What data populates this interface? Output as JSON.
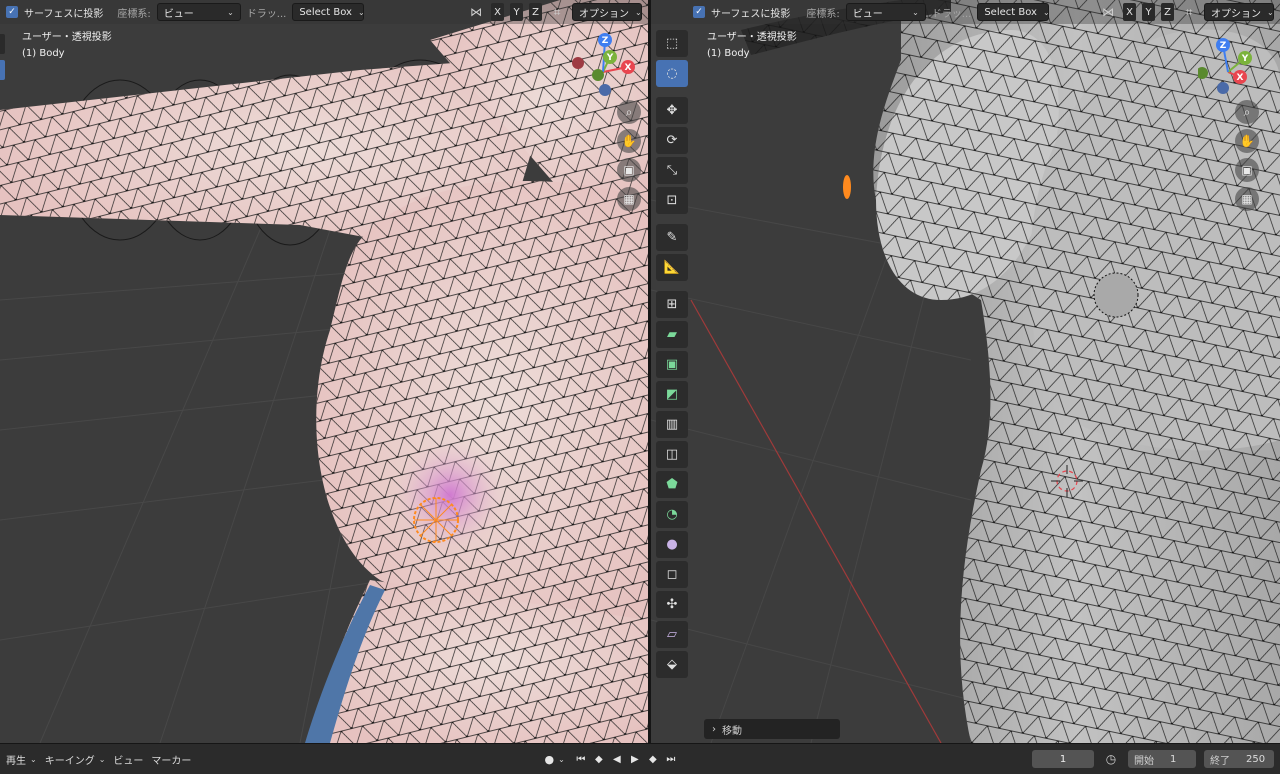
{
  "left_viewport": {
    "header": {
      "surface_project_label": "サーフェスに投影",
      "orientation_label": "座標系:",
      "orientation_value": "ビュー",
      "drag_label": "ドラッ...",
      "drag_value": "Select Box",
      "axes": [
        "X",
        "Y",
        "Z"
      ],
      "options_label": "オプション"
    },
    "info": {
      "view_name": "ユーザー・透視投影",
      "object_name": "(1) Body"
    },
    "gizmo": {
      "x": "X",
      "y": "Y",
      "z": "Z"
    },
    "nav_icons": [
      "zoom-icon",
      "hand-icon",
      "camera-icon",
      "grid-icon"
    ]
  },
  "right_viewport": {
    "header": {
      "surface_project_label": "サーフェスに投影",
      "orientation_label": "座標系:",
      "orientation_value": "ビュー",
      "drag_label": "ドラッ...",
      "drag_value": "Select Box",
      "axes": [
        "X",
        "Y",
        "Z"
      ],
      "options_label": "オプション"
    },
    "info": {
      "view_name": "ユーザー・透視投影",
      "object_name": "(1) Body"
    },
    "gizmo": {
      "x": "X",
      "y": "Y",
      "z": "Z"
    },
    "tools": [
      "select-box-icon",
      "select-circle-icon",
      "move-icon",
      "rotate-icon",
      "scale-icon",
      "transform-icon",
      "annotate-icon",
      "measure-icon",
      "add-cube-icon",
      "extrude-icon",
      "inset-icon",
      "bevel-icon",
      "loopcut-icon",
      "knife-icon",
      "polybuild-icon",
      "spin-icon",
      "smooth-icon",
      "edge-slide-icon",
      "shrink-icon",
      "shear-icon",
      "rip-icon"
    ],
    "last_operator": "移動"
  },
  "timeline": {
    "playback_label": "再生",
    "keying_label": "キーイング",
    "view_label": "ビュー",
    "marker_label": "マーカー",
    "current_frame": "1",
    "start_label": "開始",
    "start_value": "1",
    "end_label": "終了",
    "end_value": "250"
  },
  "colors": {
    "accent": "#4772b3",
    "viewport_bg": "#3c3c3c",
    "mesh_pink": "#ecc9c7",
    "mesh_gray": "#b4b4b4",
    "selection_orange": "#ff8a1e",
    "axis_x": "#e8454f",
    "axis_y": "#7bb33c",
    "axis_z": "#3f7ef0"
  }
}
